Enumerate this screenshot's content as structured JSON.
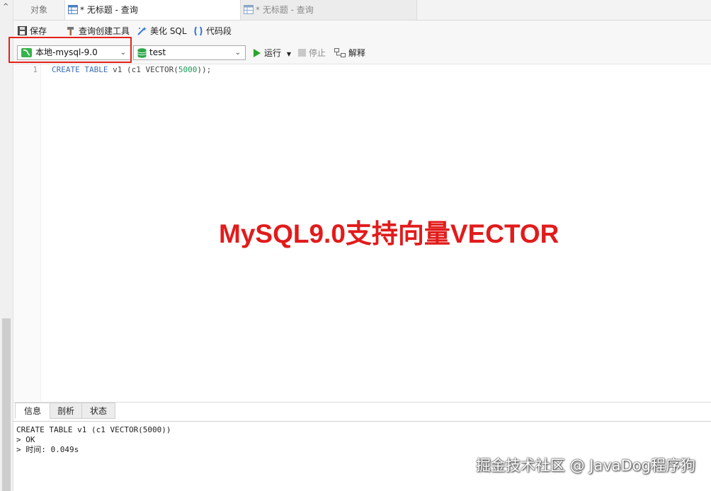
{
  "tabs": {
    "objects_label": "对象",
    "active_label": "* 无标题 - 查询",
    "inactive_label": "* 无标题 - 查询"
  },
  "toolbar1": {
    "save_label": "保存",
    "query_builder_label": "查询创建工具",
    "beautify_label": "美化 SQL",
    "snippet_label": "代码段"
  },
  "toolbar2": {
    "connection_value": "本地-mysql-9.0",
    "database_value": "test",
    "run_label": "运行",
    "stop_label": "停止",
    "explain_label": "解释"
  },
  "editor": {
    "line_number": "1",
    "code_kw1": "CREATE TABLE",
    "code_mid": " v1 (c1 VECTOR(",
    "code_num": "5000",
    "code_end": "));"
  },
  "overlay": {
    "title": "MySQL9.0支持向量VECTOR"
  },
  "bottom": {
    "tabs": [
      "信息",
      "剖析",
      "状态"
    ],
    "log_line1": "CREATE TABLE v1 (c1 VECTOR(5000))",
    "log_line2": "> OK",
    "log_line3": "> 时间: 0.049s"
  },
  "watermark": "掘金技术社区 @ JavaDog程序狗",
  "colors": {
    "highlight": "#e52119",
    "overlay_text": "#e21b1b",
    "keyword": "#3b6fb6",
    "number": "#1a9a55",
    "run_green": "#2aa52a"
  }
}
